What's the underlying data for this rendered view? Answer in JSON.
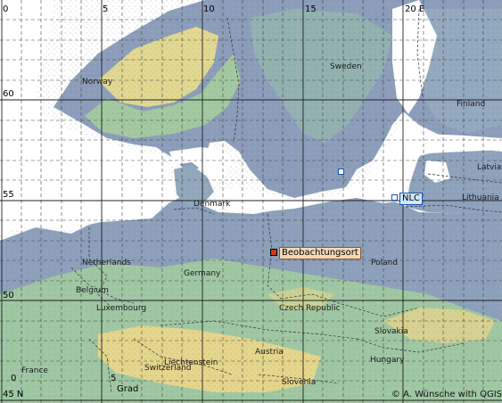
{
  "map": {
    "longitude_labels": [
      "0",
      "5",
      "10",
      "15",
      "20 E"
    ],
    "latitude_labels": [
      "60",
      "55",
      "50",
      "45 N"
    ],
    "grid_unit_label": "Grad",
    "scale_labels": [
      "0",
      "5"
    ],
    "countries": {
      "norway": "Norway",
      "sweden": "Sweden",
      "finland": "Finland",
      "latvia": "Latvia",
      "lithuania": "Lithuania",
      "denmark": "Denmark",
      "netherlands": "Netherlands",
      "belgium": "Belgium",
      "luxembourg": "Luxembourg",
      "germany": "Germany",
      "poland": "Poland",
      "czech": "Czech Republic",
      "slovakia": "Slovakia",
      "austria": "Austria",
      "hungary": "Hungary",
      "liechtenstein": "Liechtenstein",
      "switzerland": "Switzerland",
      "slovenia": "Slovenia",
      "france": "France"
    },
    "markers": {
      "observation_label": "Beobachtungsort",
      "nlc_label": "NLC"
    },
    "credit": "© A. Wünsche with QGIS",
    "colors": {
      "sea": "#ffffff",
      "lowland": "#8a9cb8",
      "green": "#9cc8a0",
      "yellow": "#e8dc8e",
      "grid": "#333333",
      "border": "#333333",
      "observation_marker": "#d43a0e",
      "nlc_marker": "#1a4fb5"
    }
  }
}
